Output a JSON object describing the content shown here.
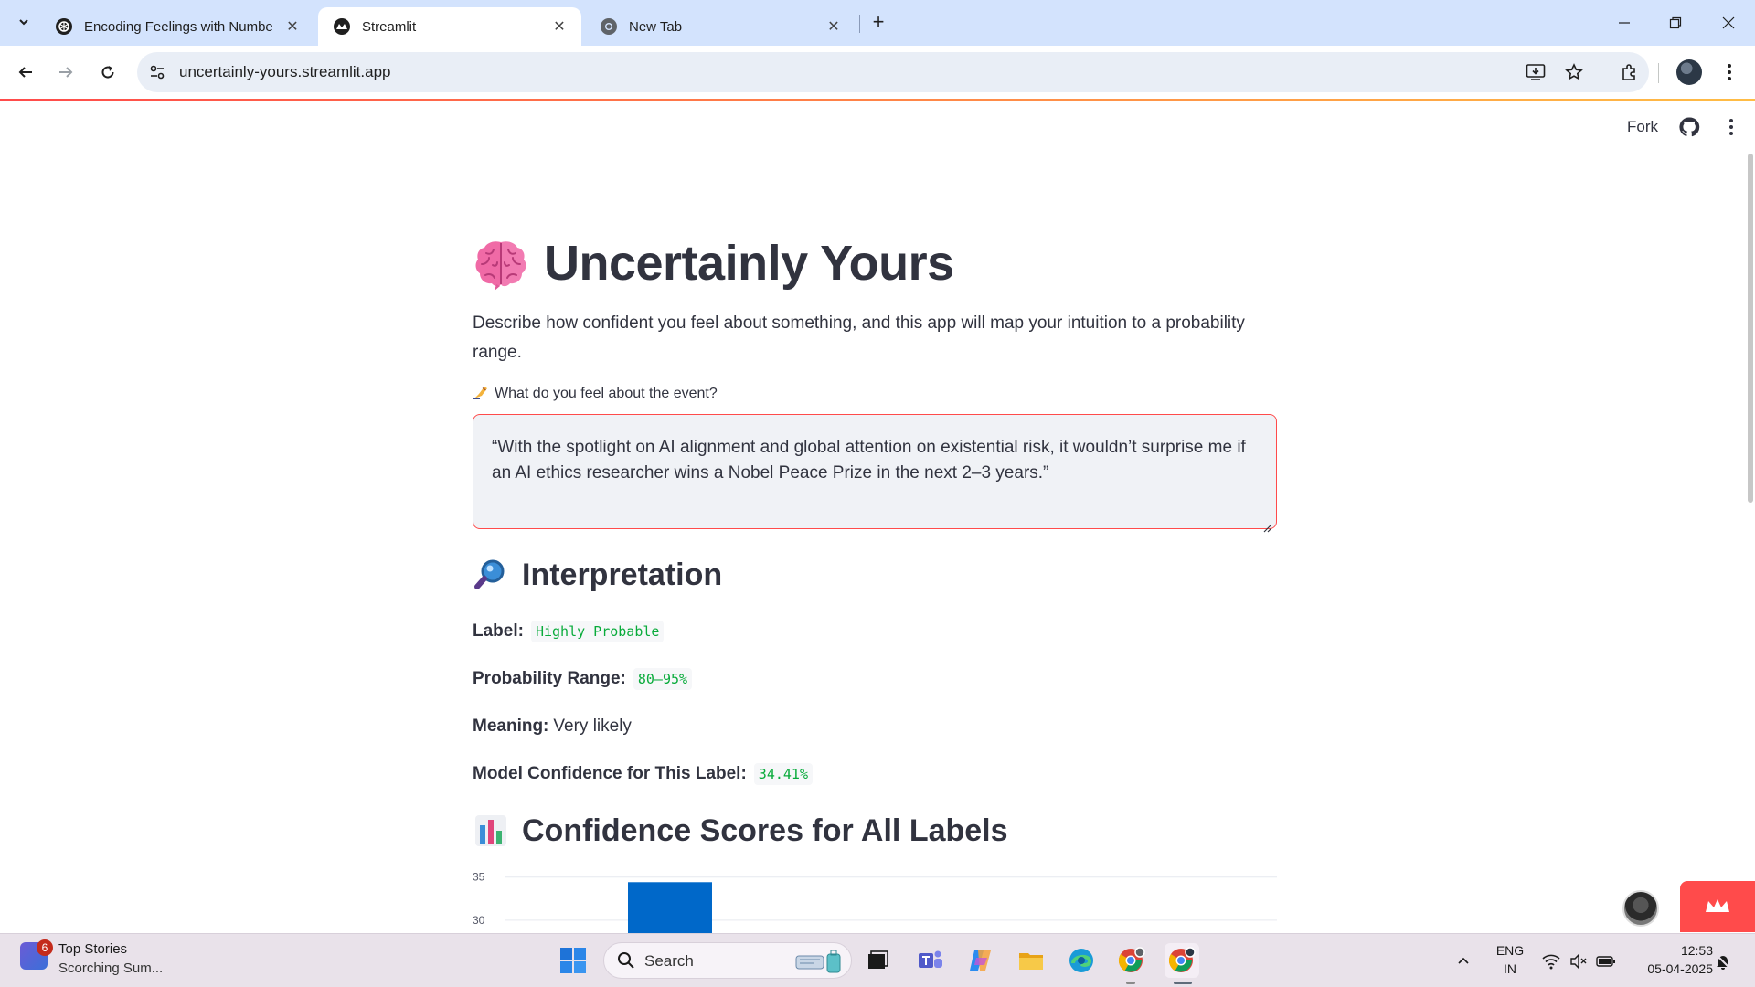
{
  "browser": {
    "tabs": [
      {
        "title": "Encoding Feelings with Numbe",
        "active": false,
        "icon": "openai-icon"
      },
      {
        "title": "Streamlit",
        "active": true,
        "icon": "streamlit-icon"
      },
      {
        "title": "New Tab",
        "active": false,
        "icon": "chrome-icon"
      }
    ],
    "url": "uncertainly-yours.streamlit.app"
  },
  "header": {
    "fork_label": "Fork"
  },
  "app": {
    "title": "Uncertainly Yours",
    "title_icon": "brain-icon",
    "description": "Describe how confident you feel about something, and this app will map your intuition to a probability range.",
    "input_label": "What do you feel about the event?",
    "input_label_icon": "writing-hand-icon",
    "input_value": "“With the spotlight on AI alignment and global attention on existential risk, it wouldn’t surprise me if an AI ethics researcher wins a Nobel Peace Prize in the next 2–3 years.”",
    "interpretation": {
      "heading": "Interpretation",
      "heading_icon": "magnifier-icon",
      "label_key": "Label:",
      "label_value": "Highly Probable",
      "range_key": "Probability Range:",
      "range_value": "80–95%",
      "meaning_key": "Meaning:",
      "meaning_value": "Very likely",
      "confidence_key": "Model Confidence for This Label:",
      "confidence_value": "34.41%"
    },
    "confidence_heading": "Confidence Scores for All Labels",
    "confidence_heading_icon": "bar-chart-icon",
    "accent_color": "#ff4b4b",
    "code_color": "#09ab3b"
  },
  "chart_data": {
    "type": "bar",
    "ytick_labels": [
      "35",
      "30"
    ],
    "ylim_visible": [
      28.5,
      35.5
    ],
    "bars_visible": [
      {
        "value": 34.41
      }
    ],
    "bar_color": "#0068c9"
  },
  "taskbar": {
    "news_title": "Top Stories",
    "news_subtitle": "Scorching Sum...",
    "news_badge": "6",
    "search_label": "Search",
    "language_line1": "ENG",
    "language_line2": "IN",
    "time": "12:53",
    "date": "05-04-2025"
  }
}
